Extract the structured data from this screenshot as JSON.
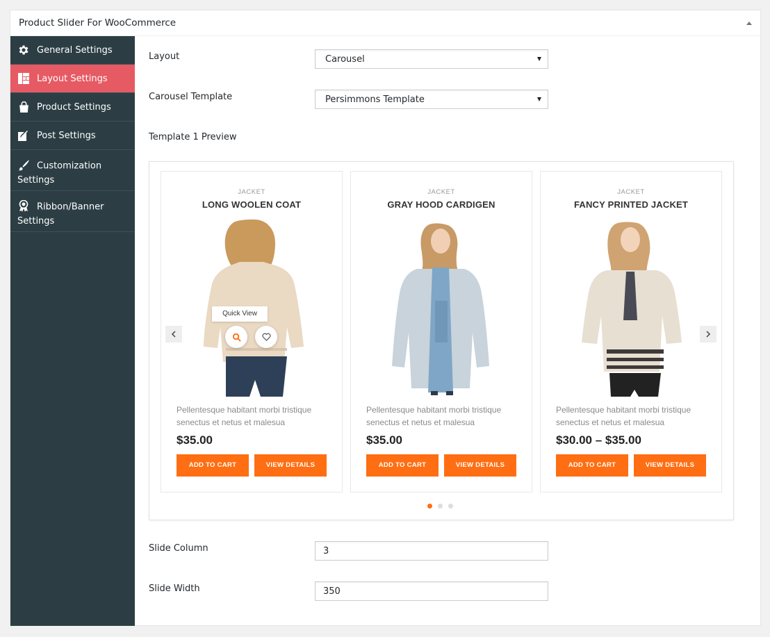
{
  "panel": {
    "title": "Product Slider For WooCommerce"
  },
  "sidebar": {
    "items": [
      {
        "label": "General Settings",
        "icon": "gear-icon",
        "active": false
      },
      {
        "label": "Layout Settings",
        "icon": "layout-grid-icon",
        "active": true
      },
      {
        "label": "Product Settings",
        "icon": "shop-bag-icon",
        "active": false
      },
      {
        "label": "Post Settings",
        "icon": "edit-post-icon",
        "active": false
      },
      {
        "label": "Customization Settings",
        "icon": "paint-brush-icon",
        "active": false
      },
      {
        "label": "Ribbon/Banner Settings",
        "icon": "award-ribbon-icon",
        "active": false
      }
    ]
  },
  "form": {
    "layout_label": "Layout",
    "layout_value": "Carousel",
    "template_label": "Carousel Template",
    "template_value": "Persimmons Template",
    "preview_label": "Template 1 Preview",
    "slide_column_label": "Slide Column",
    "slide_column_value": "3",
    "slide_width_label": "Slide Width",
    "slide_width_value": "350"
  },
  "preview": {
    "quick_view": "Quick View",
    "products": [
      {
        "category": "JACKET",
        "title": "LONG WOOLEN COAT",
        "description": "Pellentesque habitant morbi tristique senectus et netus et malesua",
        "price": "$35.00",
        "add_to_cart": "ADD TO CART",
        "view_details": "VIEW DETAILS"
      },
      {
        "category": "JACKET",
        "title": "GRAY HOOD CARDIGEN",
        "description": "Pellentesque habitant morbi tristique senectus et netus et malesua",
        "price": "$35.00",
        "add_to_cart": "ADD TO CART",
        "view_details": "VIEW DETAILS"
      },
      {
        "category": "JACKET",
        "title": "FANCY PRINTED JACKET",
        "description": "Pellentesque habitant morbi tristique senectus et netus et malesua",
        "price": "$30.00 – $35.00",
        "add_to_cart": "ADD TO CART",
        "view_details": "VIEW DETAILS"
      }
    ],
    "active_dot": 0,
    "dot_count": 3
  },
  "colors": {
    "sidebar_bg": "#2c3e44",
    "sidebar_active": "#e65a64",
    "accent_orange": "#ff6e12"
  }
}
